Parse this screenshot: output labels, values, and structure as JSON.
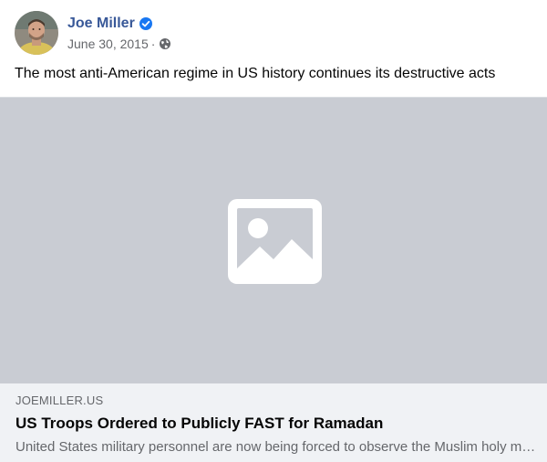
{
  "post": {
    "author": {
      "name": "Joe Miller",
      "verified": true,
      "avatar_icon": "profile-photo"
    },
    "date": "June 30, 2015",
    "separator": "·",
    "audience_icon": "globe-icon",
    "text": "The most anti-American regime in US history continues its destructive acts"
  },
  "image": {
    "placeholder_icon": "image-placeholder-icon",
    "background_color": "#c9ccd3"
  },
  "link_preview": {
    "domain": "JOEMILLER.US",
    "title": "US Troops Ordered to Publicly FAST for Ramadan",
    "description": "United States military personnel are now being forced to observe the Muslim holy month of Ramadan"
  },
  "colors": {
    "author_name": "#385898",
    "verified_badge": "#1877f2",
    "secondary_text": "#65676b",
    "preview_background": "#f0f2f5"
  }
}
